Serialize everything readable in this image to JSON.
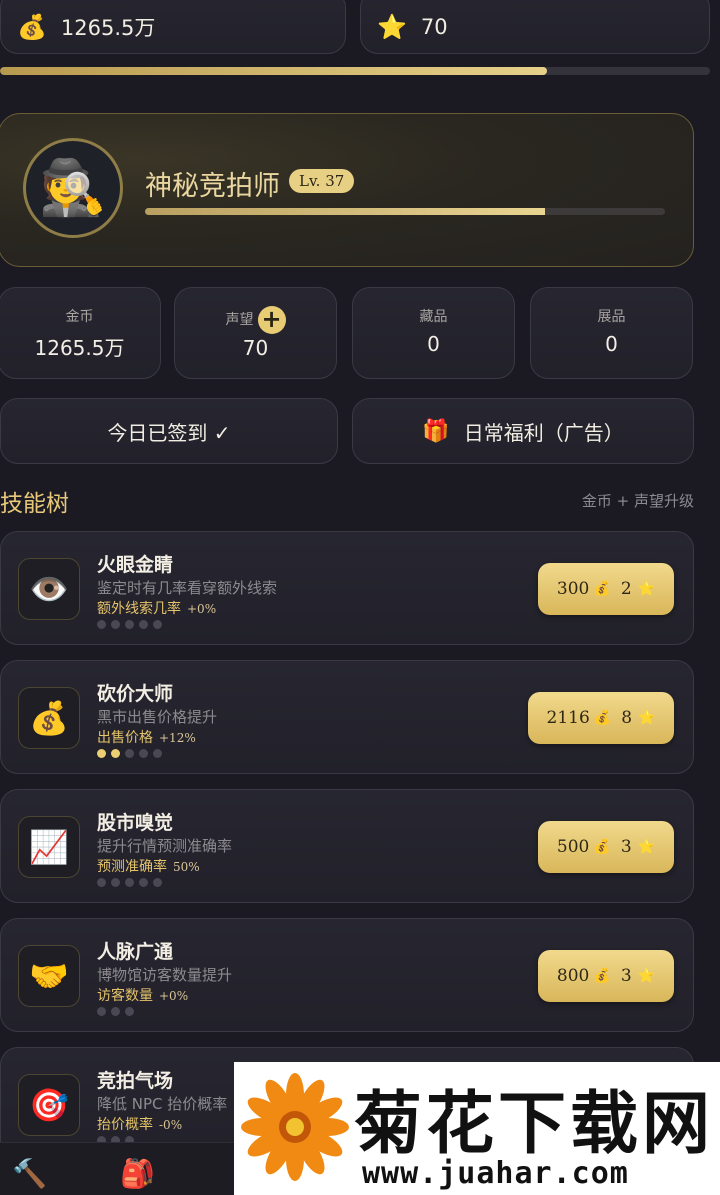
{
  "top_bar": {
    "gold_icon": "money-bag-icon",
    "gold": "1265.5万",
    "reputation_icon": "star-icon",
    "reputation": "70",
    "progress": 0.77
  },
  "profile": {
    "avatar_icon": "detective-icon",
    "name": "神秘竞拍师",
    "level": "Lv. 37",
    "progress": 0.77
  },
  "stats": [
    {
      "label": "金币",
      "value": "1265.5万"
    },
    {
      "label": "声望",
      "value": "70",
      "plus": "+"
    },
    {
      "label": "藏品",
      "value": "0"
    },
    {
      "label": "展品",
      "value": "0"
    }
  ],
  "actions": {
    "signin": "今日已签到 ✓",
    "welfare": "日常福利（广告）",
    "welfare_icon": "gift-icon"
  },
  "skill_tree": {
    "title": "技能树",
    "hint": "金币 + 声望升级"
  },
  "skills": [
    {
      "icon": "eye-icon",
      "glyph": "👁️",
      "name": "火眼金睛",
      "desc": "鉴定时有几率看穿额外线索",
      "effect": "额外线索几率",
      "effect_value": "+0%",
      "level": 0,
      "max": 5,
      "cost_gold": "300",
      "cost_rep": "2"
    },
    {
      "icon": "money-bag-icon",
      "glyph": "💰",
      "name": "砍价大师",
      "desc": "黑市出售价格提升",
      "effect": "出售价格",
      "effect_value": "+12%",
      "level": 2,
      "max": 5,
      "cost_gold": "2116",
      "cost_rep": "8"
    },
    {
      "icon": "chart-up-icon",
      "glyph": "📈",
      "name": "股市嗅觉",
      "desc": "提升行情预测准确率",
      "effect": "预测准确率",
      "effect_value": "50%",
      "level": 0,
      "max": 5,
      "cost_gold": "500",
      "cost_rep": "3"
    },
    {
      "icon": "handshake-icon",
      "glyph": "🤝",
      "name": "人脉广通",
      "desc": "博物馆访客数量提升",
      "effect": "访客数量",
      "effect_value": "+0%",
      "level": 0,
      "max": 3,
      "cost_gold": "800",
      "cost_rep": "3"
    },
    {
      "icon": "target-icon",
      "glyph": "🎯",
      "name": "竞拍气场",
      "desc": "降低 NPC 抬价概率",
      "effect": "抬价概率",
      "effect_value": "-0%",
      "level": 0,
      "max": 3,
      "cost_gold": "",
      "cost_rep": ""
    }
  ],
  "bottom_nav": [
    {
      "icon": "hammer-icon",
      "glyph": "🔨"
    },
    {
      "icon": "backpack-icon",
      "glyph": "🎒"
    }
  ],
  "watermark": {
    "title": "菊花下载网",
    "url": "www.juahar.com"
  }
}
